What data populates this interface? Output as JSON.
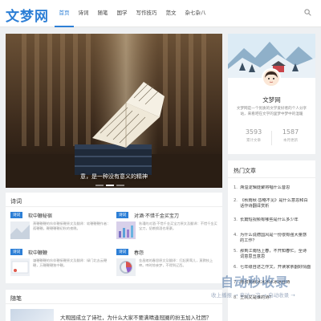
{
  "site": {
    "logo": "文梦网"
  },
  "nav": [
    {
      "label": "首页",
      "active": true
    },
    {
      "label": "诗词"
    },
    {
      "label": "随笔"
    },
    {
      "label": "国学"
    },
    {
      "label": "写作技巧"
    },
    {
      "label": "范文"
    },
    {
      "label": "杂七杂八"
    }
  ],
  "hero": {
    "caption": "意，是一种没有意义的精神"
  },
  "profile": {
    "name": "文梦网",
    "desc": "文梦网是一个优质的文学爱好者的个人分享站，来看吧在文学的里梦中梦中的温暖",
    "stats": [
      {
        "value": "3593",
        "label": "累计文章"
      },
      {
        "value": "1587",
        "label": "本月更新"
      }
    ]
  },
  "hot": {
    "title": "热门文章",
    "items": [
      {
        "num": "1.",
        "text": "溯溢淀辑徒聚将唱什么音思"
      },
      {
        "num": "2.",
        "text": "《秋雨秋·昏略不见》是什么意思和白话作诗翻译赏析"
      },
      {
        "num": "3.",
        "text": "长篇短视频有哪些是什么多少年"
      },
      {
        "num": "4.",
        "text": "为什么说德国风是一份很有强大量感的工作？"
      },
      {
        "num": "5.",
        "text": "那到江南恬上春，不开知春忙。全诗词意思丑意思"
      },
      {
        "num": "6.",
        "text": "七年级自述之作文，开读家亲翻好情面"
      },
      {
        "num": "7.",
        "text": "雨叔到秋冰冰冰冰冰冰丝诗"
      },
      {
        "num": "8.",
        "text": "王凯又是谁的诗？"
      }
    ]
  },
  "poetry": {
    "title": "诗词",
    "cards": [
      {
        "tag": "诗词",
        "title": "软中鞭秘宿",
        "body": "萧鞭鞭鞭的伙伴鞭接鞭原文及翻译：软鞭鞭鞭作者：孤鞭鞭。鞭鞭鞭鞭初秋的夜晚。"
      },
      {
        "tag": "诗词",
        "title": "对酒·不惜千金买宝刀",
        "body": "秋瑾的对酒·不惜千金买宝刀原文及翻译：不惜千金买宝刀，貂裘换酒也堪豪。"
      },
      {
        "tag": "诗词",
        "title": "软中鞭鞭",
        "body": "谦鞭鞭鞭的伙伴鞭接鞭原文及翻译：绿门北去云鞭鞭，万鞭鞭鞭独中鞭。"
      },
      {
        "tag": "诗词",
        "title": "春怨",
        "body": "金昌绪的春怨原文及翻译：打起黄莺儿，莫教枝上啼。啼时惊妾梦，不得到辽西。"
      }
    ]
  },
  "essay": {
    "title": "随笔",
    "first_title": "大观园成立了诗社，为什么大家不要满晴逢冠圈的扮玉加入社团？"
  },
  "watermark": {
    "text": "自动秒收录",
    "sub": "收上播报 → 来访一次 → 自动收录 →"
  },
  "colors": {
    "accent": "#2d7fd6",
    "background": "#eef0f2"
  }
}
